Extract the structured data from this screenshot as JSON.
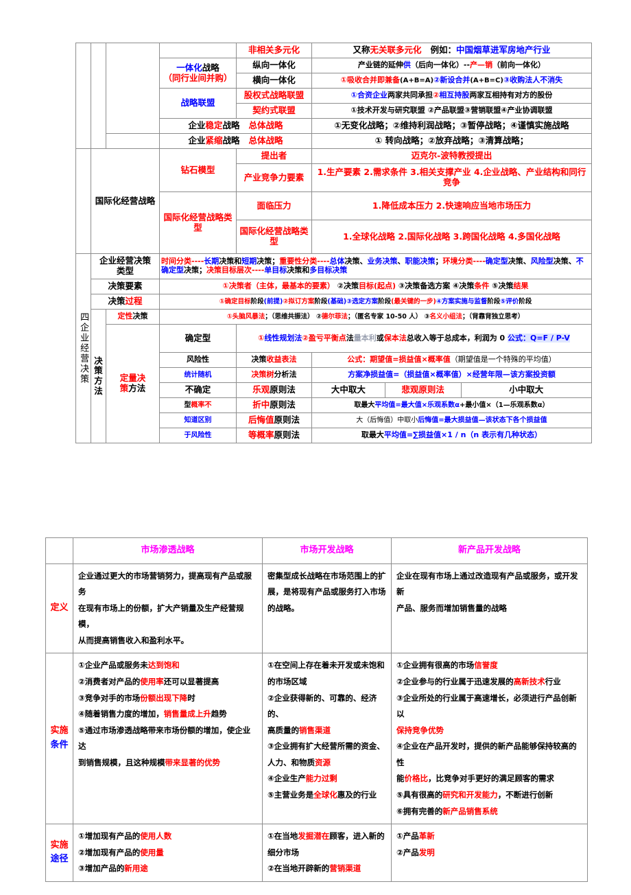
{
  "table1": {
    "vertical_label": "四企业经营决策",
    "rows": {
      "r1_empty_c2": "",
      "r1_empty_c3": "",
      "diversify_name": "",
      "diversify_type": "非相关多元化",
      "diversify_desc_a": "又称",
      "diversify_desc_b": "无关联多元化",
      "diversify_desc_c": "例如：",
      "diversify_desc_d": "中国烟草进军房地产行业",
      "integration_label_a": "一体化",
      "integration_label_b": "战略",
      "integration_label_c": "（同行业间并购）",
      "vertical_type": "纵向一体化",
      "vertical_desc_a": "产业链的延伸",
      "vertical_desc_b": "供",
      "vertical_desc_c": "（后向一体化）--",
      "vertical_desc_d": "产—",
      "vertical_desc_e": "销",
      "vertical_desc_f": "（前向一体化）",
      "horizontal_type": "横向一体化",
      "horizontal_desc_a": "①吸收合并即兼备",
      "horizontal_desc_b": "(A+B=A)",
      "horizontal_desc_c": "②新设合并",
      "horizontal_desc_d": "(A+B=C)",
      "horizontal_desc_e": "③收购法人不消失",
      "alliance_label": "战略联盟",
      "equity_alliance": "股权式战略联盟",
      "equity_desc_a": "①合资企业",
      "equity_desc_b": "两家共同承担",
      "equity_desc_c": "②",
      "equity_desc_d": "相互持股",
      "equity_desc_e": "两家互相持有对方的股份",
      "contract_alliance": "契约式联盟",
      "contract_desc": "①技术开发与研究联盟 ②产品联盟③营销联盟④产业协调联盟",
      "stable_label_a": "企业",
      "stable_label_b": "稳定",
      "stable_label_c": "战略",
      "stable_overall": "总体战略",
      "stable_desc": "①无变化战略；②维持利润战略；③暂停战略；④谨慎实施战略",
      "shrink_label_a": "企业",
      "shrink_label_b": "紧缩",
      "shrink_label_c": "战略",
      "shrink_overall": "总体战略",
      "shrink_desc": "① 转向战略；②放弃战略；③清算战略；",
      "intl_label_a": "国际化经营",
      "intl_label_b": "战略",
      "diamond_model": "钻石模型",
      "proposer_label": "提出者",
      "proposer_value": "迈克尔-波特教授提出",
      "industry_factor_label": "产业竞争力要素",
      "industry_factor_value": "1.生产要素 2.需求条件 3.相关支撑产业 4.企业战略、产业结构和同行竞争",
      "intl_type_label": "国际化经营战略类型",
      "pressure_label": "面临压力",
      "pressure_value": "1.降低成本压力 2.快速响应当地市场压力",
      "intl_strategy_label": "国际化经营战略类型",
      "intl_strategy_value": "1.全球化战略 2.国际化战略 3.跨国化战略 4.多国化战略",
      "decision_type_label_a": "企业经营决策",
      "decision_type_label_b": "类型",
      "decision_type_v1": "时间分类----",
      "decision_type_v2": "长期",
      "decision_type_v3": "决策和",
      "decision_type_v4": "短期",
      "decision_type_v5": "决策；",
      "decision_type_v6": "重要性分类",
      "decision_type_v7": "----",
      "decision_type_v8": "总体",
      "decision_type_v9": "决策、",
      "decision_type_v10": "业务决策",
      "decision_type_v11": "、",
      "decision_type_v12": "职能决策",
      "decision_type_v13": "；",
      "decision_type_v14": "环境分类",
      "decision_type_v15": "----",
      "decision_type_v16": "确定型",
      "decision_type_v17": "决策、",
      "decision_type_v18": "风险型",
      "decision_type_v19": "决策、",
      "decision_type_v20": "不确定型",
      "decision_type_v21": "决策；",
      "decision_type_v22": "决策目标层次",
      "decision_type_v23": "----",
      "decision_type_v24": "单目标",
      "decision_type_v25": "决策和",
      "decision_type_v26": "多目标决策",
      "decision_element_label_a": "决策要素",
      "decision_element_v1": "①",
      "decision_element_v2": "决策者（主体，最基本的要素）",
      "decision_element_v3": " ②决策",
      "decision_element_v4": "目标(起点)",
      "decision_element_v5": " ③决策备选方案 ④决策",
      "decision_element_v6": "条件",
      "decision_element_v7": " ⑤决策",
      "decision_element_v8": "结果",
      "decision_process_label_a": "决策",
      "decision_process_label_b": "过程",
      "decision_process_v1": "①确定目标",
      "decision_process_v2": "阶段",
      "decision_process_v3": "(前提)",
      "decision_process_v4": "②拟订方案",
      "decision_process_v5": "阶段",
      "decision_process_v6": "(基础)",
      "decision_process_v7": "③选定方案",
      "decision_process_v8": "阶段",
      "decision_process_v9": "(最关键的一步)",
      "decision_process_v10": "④方案实施与监督",
      "decision_process_v11": "阶段",
      "decision_process_v12": "⑤评价",
      "decision_process_v13": "阶段",
      "decision_method_label": "决策方法",
      "qual_label_a": "定性",
      "qual_label_b": "决策",
      "qual_v1": "①",
      "qual_v2": "头脑风暴法",
      "qual_v3": "；（思维共振法）  ②",
      "qual_v4": "德尔菲法",
      "qual_v5": "；（匿名专家 10-50 人）  ③",
      "qual_v6": "名义小组法",
      "qual_v7": "；（背靠背独立思考）",
      "quant_label_a": "定量决",
      "quant_label_b": "策",
      "quant_label_c": "方法",
      "certain_label": "确定型",
      "certain_v1": "①",
      "certain_v2": "线性规划法",
      "certain_v3": "②",
      "certain_v4": "盈亏平衡点",
      "certain_v5": "法",
      "certain_v6": "量本利",
      "certain_v7": "或",
      "certain_v8": "保本法",
      "certain_v9": "总收入等于总成本，利润为 0 ",
      "certain_v10": "公式：Q=F / P-V",
      "risk_label": "风险性",
      "risk_sub": "统计随机",
      "risk_m1": "决策",
      "risk_m1b": "收益表法",
      "risk_m1v1": "公式：",
      "risk_m1v2": "期望值=损益值×概率值",
      "risk_m1v3": "（期望值是一个特殊的平均值）",
      "risk_m2": "决策树",
      "risk_m2b": "分析法",
      "risk_m2v": "方案净损益值=（损益值×概率值）×经营年限—该方案投资额",
      "uncertain_label_a": "不确定",
      "uncertain_label_b": "型",
      "uncertain_label_c": "概率不",
      "uncertain_label_d": "知道区别",
      "uncertain_label_e": "于风险性",
      "u1_name_a": "乐观",
      "u1_name_b": "原则法",
      "u1_value": "大中取大",
      "u1_name2_a": "悲观原则法",
      "u1_value2": "小中取大",
      "u2_name_a": "折中",
      "u2_name_b": "原则法",
      "u2_v1": "取最大",
      "u2_v2": "平均值=最大值×乐观系数α",
      "u2_v3": "+最小值×（1—乐观系数α）",
      "u3_name_a": "后悔值",
      "u3_name_b": "原则法",
      "u3_v1": "大（后悔值）中取小",
      "u3_v2": "后悔值=最大损益值—该状态下各个损益值",
      "u4_name_a": "等概率",
      "u4_name_b": "原则法",
      "u4_v1": "取最大",
      "u4_v2": "平均值=∑损益值×1 / n（n 表示有几种状态）"
    }
  },
  "table2": {
    "headers": [
      "",
      "市场渗透战略",
      "市场开发战略",
      "新产品开发战略"
    ],
    "rows": [
      {
        "label_line1": "定义",
        "label_line2": "",
        "cells": [
          {
            "lines": [
              {
                "parts": [
                  {
                    "t": "企业通过更大的市场营销努力，提高现有产品或服务",
                    "c": "k"
                  }
                ]
              },
              {
                "parts": [
                  {
                    "t": "在现有市场上的份额，扩大产销量及生产经营规模，",
                    "c": "k"
                  }
                ]
              },
              {
                "parts": [
                  {
                    "t": "从而提高销售收入和盈利水平。",
                    "c": "k"
                  }
                ]
              }
            ]
          },
          {
            "lines": [
              {
                "parts": [
                  {
                    "t": "密集型成长战略在市场范围上的扩",
                    "c": "k"
                  }
                ]
              },
              {
                "parts": [
                  {
                    "t": "展，是将现有产品或服务打入市场",
                    "c": "k"
                  }
                ]
              },
              {
                "parts": [
                  {
                    "t": "的战略。",
                    "c": "k"
                  }
                ]
              }
            ]
          },
          {
            "lines": [
              {
                "parts": [
                  {
                    "t": "企业在现有市场上通过改造现有产品或服务，或开发新",
                    "c": "k"
                  }
                ]
              },
              {
                "parts": [
                  {
                    "t": "产品、服务而增加销售量的战略",
                    "c": "k"
                  }
                ]
              }
            ]
          }
        ]
      },
      {
        "label_line1": "实施",
        "label_line2": "条件",
        "cells": [
          {
            "lines": [
              {
                "parts": [
                  {
                    "t": "①企业产品或服务未",
                    "c": "k"
                  },
                  {
                    "t": "达到饱和",
                    "c": "r"
                  }
                ]
              },
              {
                "parts": [
                  {
                    "t": "②消费者对产品的",
                    "c": "k"
                  },
                  {
                    "t": "使用率",
                    "c": "r"
                  },
                  {
                    "t": "还可以显著提高",
                    "c": "k"
                  }
                ]
              },
              {
                "parts": [
                  {
                    "t": "③竞争对手的市场",
                    "c": "k"
                  },
                  {
                    "t": "份额出现下降",
                    "c": "r"
                  },
                  {
                    "t": "时",
                    "c": "k"
                  }
                ]
              },
              {
                "parts": [
                  {
                    "t": "④随着销售力度的增加，",
                    "c": "k"
                  },
                  {
                    "t": "销售量成上升",
                    "c": "r"
                  },
                  {
                    "t": "趋势",
                    "c": "k"
                  }
                ]
              },
              {
                "parts": [
                  {
                    "t": "⑤通过市场渗透战略带来市场份额的增加，使企业达",
                    "c": "k"
                  }
                ]
              },
              {
                "parts": [
                  {
                    "t": "到销售规模，且这种规模",
                    "c": "k"
                  },
                  {
                    "t": "带来显著的优势",
                    "c": "r"
                  }
                ]
              }
            ]
          },
          {
            "lines": [
              {
                "parts": [
                  {
                    "t": "①在空间上存在着未开发或未饱和",
                    "c": "k"
                  }
                ]
              },
              {
                "parts": [
                  {
                    "t": "的市场区域",
                    "c": "k"
                  }
                ]
              },
              {
                "parts": [
                  {
                    "t": "②企业获得新的、可靠的、经济的、",
                    "c": "k"
                  }
                ]
              },
              {
                "parts": [
                  {
                    "t": "高质量的",
                    "c": "k"
                  },
                  {
                    "t": "销售渠道",
                    "c": "r"
                  }
                ]
              },
              {
                "parts": [
                  {
                    "t": "③企业拥有扩大经营所需的资金、",
                    "c": "k"
                  }
                ]
              },
              {
                "parts": [
                  {
                    "t": "人力、和物质",
                    "c": "k"
                  },
                  {
                    "t": "资源",
                    "c": "r"
                  }
                ]
              },
              {
                "parts": [
                  {
                    "t": "④企业生产",
                    "c": "k"
                  },
                  {
                    "t": "能力过剩",
                    "c": "r"
                  }
                ]
              },
              {
                "parts": [
                  {
                    "t": "⑤主营业务是",
                    "c": "k"
                  },
                  {
                    "t": "全球化",
                    "c": "r"
                  },
                  {
                    "t": "惠及的行业",
                    "c": "k"
                  }
                ]
              }
            ]
          },
          {
            "lines": [
              {
                "parts": [
                  {
                    "t": "①企业拥有很高的市场",
                    "c": "k"
                  },
                  {
                    "t": "信誉度",
                    "c": "r"
                  }
                ]
              },
              {
                "parts": [
                  {
                    "t": "②企业参与的行业属于迅速发展的",
                    "c": "k"
                  },
                  {
                    "t": "高新技术",
                    "c": "r"
                  },
                  {
                    "t": "行业",
                    "c": "k"
                  }
                ]
              },
              {
                "parts": [
                  {
                    "t": "③企业所处的行业属于高速增长，必须进行产品创新以",
                    "c": "k"
                  }
                ]
              },
              {
                "parts": [
                  {
                    "t": "保持竞争优势",
                    "c": "r"
                  }
                ]
              },
              {
                "parts": [
                  {
                    "t": "④企业在产品开发时，提供的新产品能够保持较高的性",
                    "c": "k"
                  }
                ]
              },
              {
                "parts": [
                  {
                    "t": "能",
                    "c": "k"
                  },
                  {
                    "t": "价格比",
                    "c": "r"
                  },
                  {
                    "t": "，比竞争对手更好的满足顾客的需求",
                    "c": "k"
                  }
                ]
              },
              {
                "parts": [
                  {
                    "t": "⑤具有很高的",
                    "c": "k"
                  },
                  {
                    "t": "研究和开发能力",
                    "c": "r"
                  },
                  {
                    "t": "，不断进行创新",
                    "c": "k"
                  }
                ]
              },
              {
                "parts": [
                  {
                    "t": "⑥拥有完善的",
                    "c": "k"
                  },
                  {
                    "t": "新产品销售系统",
                    "c": "r"
                  }
                ]
              }
            ]
          }
        ]
      },
      {
        "label_line1": "实施",
        "label_line2": "途径",
        "cells": [
          {
            "lines": [
              {
                "parts": [
                  {
                    "t": "①增加现有产品的",
                    "c": "k"
                  },
                  {
                    "t": "使用人数",
                    "c": "r"
                  }
                ]
              },
              {
                "parts": [
                  {
                    "t": "②增加现有产品的",
                    "c": "k"
                  },
                  {
                    "t": "使用量",
                    "c": "r"
                  }
                ]
              },
              {
                "parts": [
                  {
                    "t": "③增加产品的",
                    "c": "k"
                  },
                  {
                    "t": "新用途",
                    "c": "r"
                  }
                ]
              }
            ]
          },
          {
            "lines": [
              {
                "parts": [
                  {
                    "t": "①在当地",
                    "c": "k"
                  },
                  {
                    "t": "发掘潜在",
                    "c": "r"
                  },
                  {
                    "t": "顾客，进入新的",
                    "c": "k"
                  }
                ]
              },
              {
                "parts": [
                  {
                    "t": "细分市场",
                    "c": "k"
                  }
                ]
              },
              {
                "parts": [
                  {
                    "t": "②在当地开辟新的",
                    "c": "k"
                  },
                  {
                    "t": "营销渠道",
                    "c": "r"
                  }
                ]
              }
            ]
          },
          {
            "lines": [
              {
                "parts": [
                  {
                    "t": "①产品",
                    "c": "k"
                  },
                  {
                    "t": "革新",
                    "c": "r"
                  }
                ]
              },
              {
                "parts": [
                  {
                    "t": "②产品",
                    "c": "k"
                  },
                  {
                    "t": "发明",
                    "c": "r"
                  }
                ]
              }
            ]
          }
        ]
      }
    ]
  },
  "colors": {
    "red": "#ff0000",
    "blue": "#0000ff",
    "magenta": "#ff00ff",
    "black": "#000000",
    "grayborder": "#8d8d8d",
    "highlight": "#dfe6ff"
  }
}
